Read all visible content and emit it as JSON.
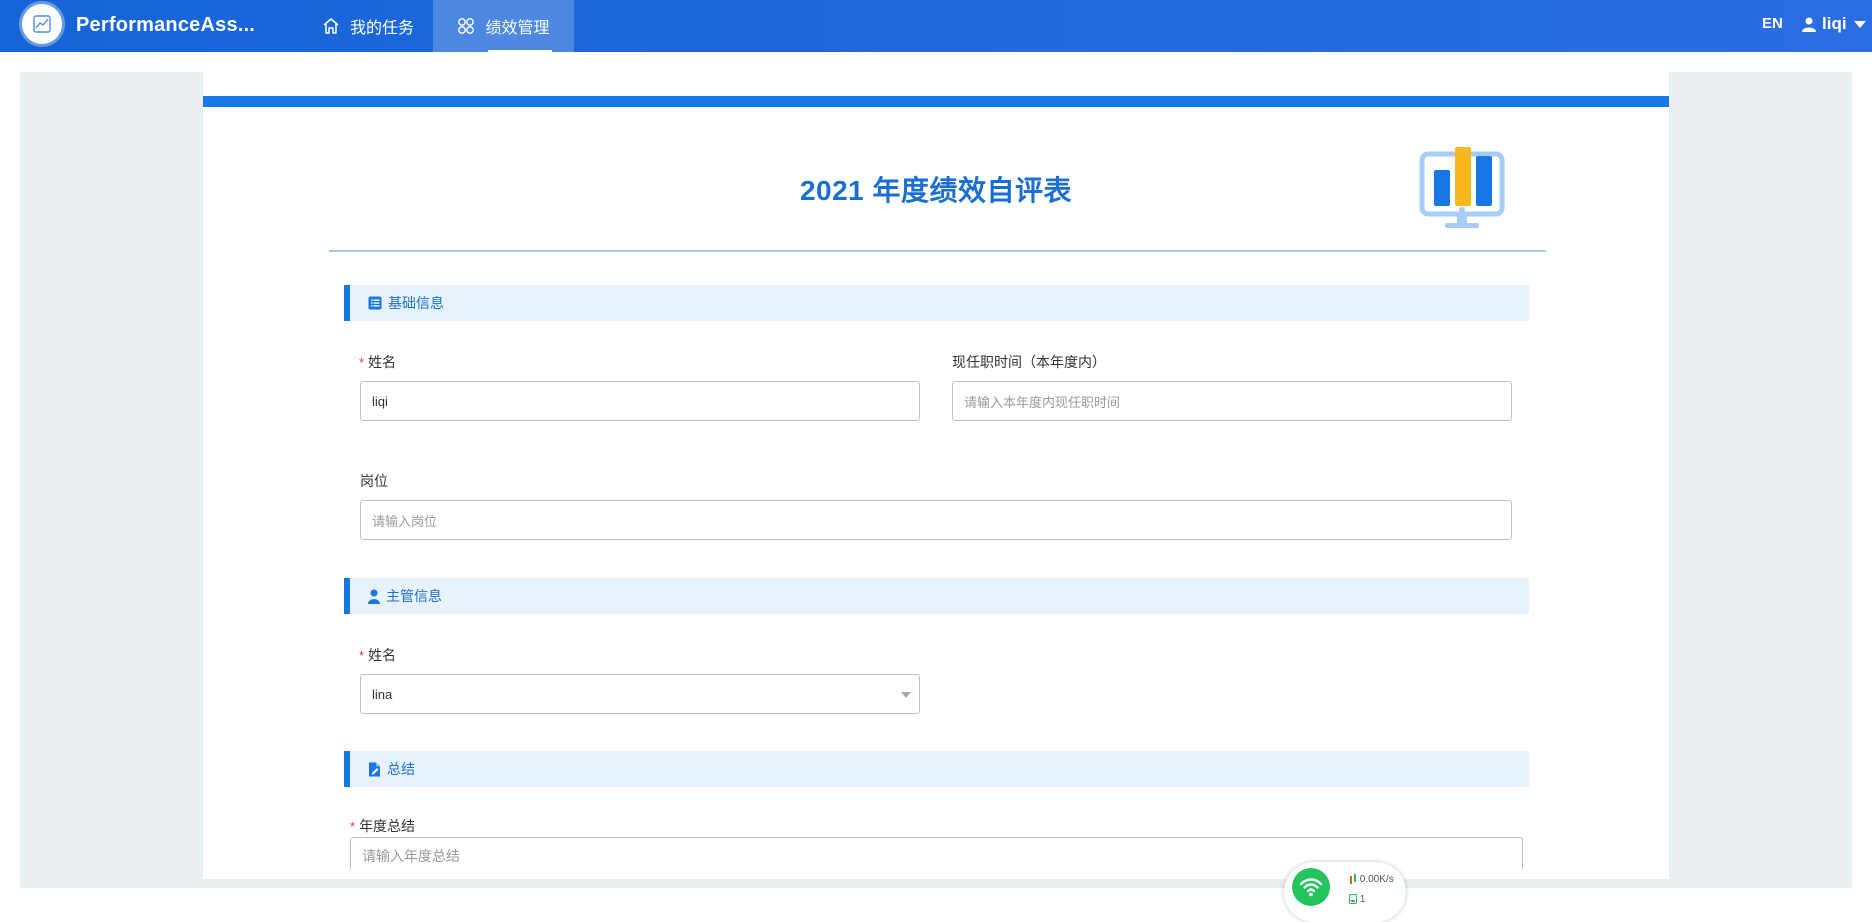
{
  "colors": {
    "brand": "#1677e5",
    "nav": "#1e66dc",
    "section_bg": "#e8f2fd",
    "required": "#e53935",
    "chart_yellow": "#f7b91f"
  },
  "navbar": {
    "app_title": "PerformanceAss...",
    "items": [
      {
        "label": "我的任务",
        "icon": "home-icon",
        "active": false
      },
      {
        "label": "绩效管理",
        "icon": "apps-grid-icon",
        "active": true
      }
    ],
    "lang_toggle": "EN",
    "user_name": "liqi"
  },
  "form": {
    "title": "2021 年度绩效自评表",
    "sections": {
      "basic": {
        "title": "基础信息",
        "icon": "list-icon",
        "name_label": "姓名",
        "name_value": "liqi",
        "tenure_label": "现任职时间（本年度内）",
        "tenure_placeholder": "请输入本年度内现任职时间",
        "position_label": "岗位",
        "position_placeholder": "请输入岗位"
      },
      "supervisor": {
        "title": "主管信息",
        "icon": "user-icon",
        "name_label": "姓名",
        "name_value": "lina"
      },
      "summary": {
        "title": "总结",
        "icon": "document-edit-icon",
        "annual_label": "年度总结",
        "annual_placeholder": "请输入年度总结"
      }
    },
    "required_mark": "*"
  },
  "network_widget": {
    "speed": "0.00K/s",
    "count": "1"
  }
}
